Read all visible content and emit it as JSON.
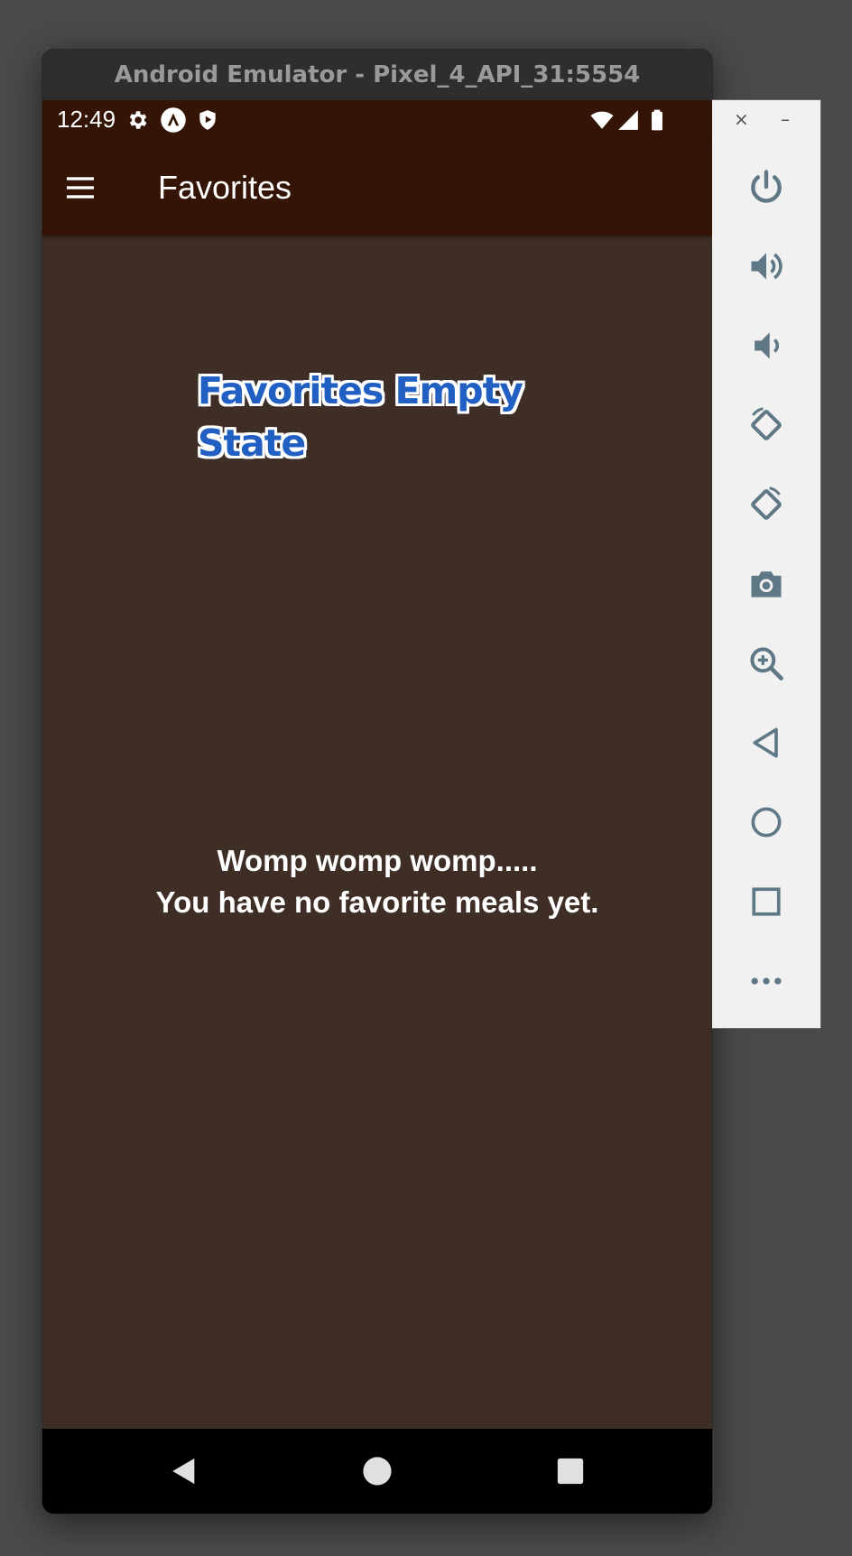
{
  "window": {
    "title": "Android Emulator - Pixel_4_API_31:5554"
  },
  "status_bar": {
    "time": "12:49",
    "left_icons": [
      "gear-icon",
      "a-logo-icon",
      "shield-icon"
    ],
    "right_icons": [
      "wifi-icon",
      "cellular-signal-icon",
      "battery-icon"
    ]
  },
  "app_bar": {
    "title": "Favorites",
    "menu_icon": "hamburger-menu-icon"
  },
  "annotation": {
    "line1": "Favorites Empty",
    "line2": "State"
  },
  "empty_state": {
    "line1": "Womp womp womp.....",
    "line2": "You have no favorite meals yet."
  },
  "nav_bar": {
    "buttons": [
      "back-triangle-icon",
      "home-circle-icon",
      "recents-square-icon"
    ]
  },
  "side_panel": {
    "close_glyph": "×",
    "minimize_glyph": "–",
    "buttons": [
      "power-icon",
      "volume-up-icon",
      "volume-down-icon",
      "rotate-left-icon",
      "rotate-right-icon",
      "camera-icon",
      "zoom-icon",
      "back-icon",
      "home-icon",
      "overview-icon",
      "more-icon"
    ]
  },
  "colors": {
    "desktop_background": "#4a4a4a",
    "status_and_app_bar": "#341405",
    "screen_background": "#3e2e26",
    "annotation_blue": "#2160c2",
    "panel_icon": "#5f7886"
  }
}
